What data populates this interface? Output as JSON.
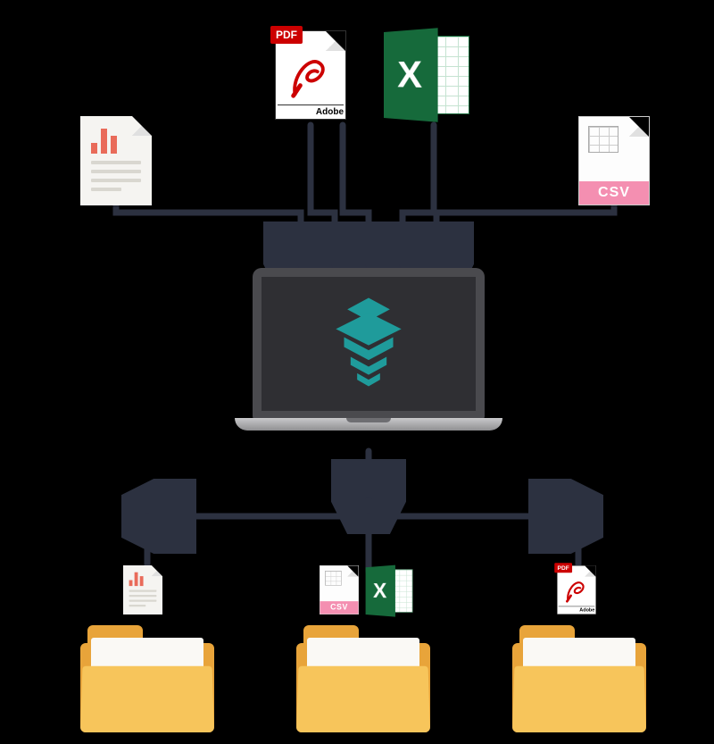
{
  "inputs": {
    "report": {
      "name": "report-document"
    },
    "pdf": {
      "badge": "PDF",
      "brand": "Adobe"
    },
    "excel": {
      "letter": "X"
    },
    "csv": {
      "label": "CSV"
    }
  },
  "processor": {
    "name": "laptop-processor"
  },
  "outputs": {
    "folder1": {
      "content": "report",
      "report": {
        "name": "report-document"
      }
    },
    "folder2": {
      "content": "csv-excel",
      "csv": {
        "label": "CSV"
      },
      "excel": {
        "letter": "X"
      }
    },
    "folder3": {
      "content": "pdf",
      "pdf": {
        "badge": "PDF",
        "brand": "Adobe"
      }
    }
  },
  "colors": {
    "arrow": "#2c3140",
    "folder_back": "#e8a43a",
    "folder_front": "#f7c55b",
    "excel_green": "#166a3b",
    "pdf_red": "#cc0000",
    "csv_pink": "#f48fb1",
    "report_accent": "#e96b5a",
    "logo_teal": "#1f9b9b"
  }
}
